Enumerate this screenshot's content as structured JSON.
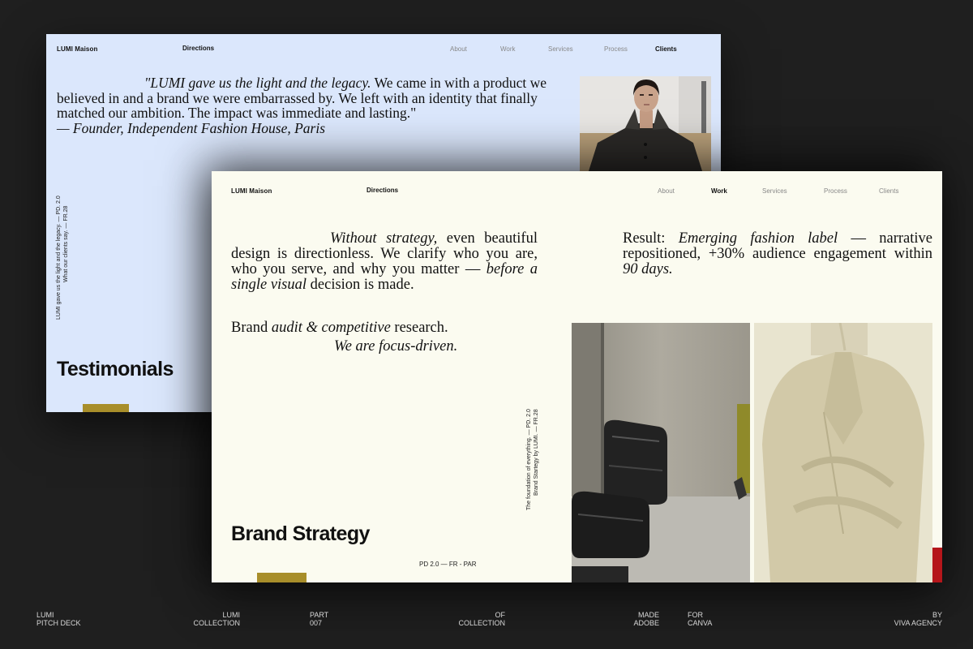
{
  "back_slide": {
    "nav": {
      "brand": "LUMI Maison",
      "directions": "Directions",
      "items": [
        {
          "label": "About",
          "active": false
        },
        {
          "label": "Work",
          "active": false
        },
        {
          "label": "Services",
          "active": false
        },
        {
          "label": "Process",
          "active": false
        },
        {
          "label": "Clients",
          "active": true
        }
      ]
    },
    "quote": {
      "italic_lead": "\"LUMI gave us the light and the legacy.",
      "body": " We came in with a product we believed in and a brand we were embarrassed by. We left with an identity that finally matched our ambition. The impact was immediate and lasting.\"",
      "attribution": "— Founder, Independent Fashion House, Paris"
    },
    "side_text": {
      "line1": "LUMI gave us the light and the legacy. — PD. 2.0",
      "line2": "What our clients say. — FR.28"
    },
    "title": "Testimonials",
    "accent_color": "#a88e2a",
    "background": "#dbe7fc"
  },
  "front_slide": {
    "nav": {
      "brand": "LUMI Maison",
      "directions": "Directions",
      "items": [
        {
          "label": "About",
          "active": false
        },
        {
          "label": "Work",
          "active": true
        },
        {
          "label": "Services",
          "active": false
        },
        {
          "label": "Process",
          "active": false
        },
        {
          "label": "Clients",
          "active": false
        }
      ]
    },
    "intro": {
      "italic1": "Without strategy,",
      "text1": " even beautiful design is directionless. We clarify who you are, who you serve, and why you matter — ",
      "italic2": "before a single visual",
      "text2": " decision is made."
    },
    "result": {
      "prefix": "Result: ",
      "italic1": "Emerging fashion label",
      "text1": " — narrative repositioned, +30% audience engagement within ",
      "italic2": "90 days.",
      "text2": ""
    },
    "audit": {
      "prefix": "Brand ",
      "italic": "audit & competitive",
      "suffix": " research."
    },
    "focus": "We are focus-driven.",
    "side_text": {
      "line1": "The foundation of everything. — PD. 2.0",
      "line2": "Brand Startegy by LUMI. — FR.28"
    },
    "title": "Brand Strategy",
    "code": "PD 2.0 — FR - PAR",
    "accent_color": "#a88e2a",
    "red_color": "#b5161b",
    "background": "#fbfbf0"
  },
  "footer": [
    {
      "line1": "LUMI",
      "line2": "PITCH DECK",
      "align": "left"
    },
    {
      "line1": "LUMI",
      "line2": "COLLECTION",
      "align": "right"
    },
    {
      "line1": "PART",
      "line2": "007",
      "align": "left"
    },
    {
      "line1": "OF",
      "line2": "COLLECTION",
      "align": "right"
    },
    {
      "line1": "MADE",
      "line2": "ADOBE",
      "align": "right"
    },
    {
      "line1": "FOR",
      "line2": "CANVA",
      "align": "left"
    },
    {
      "line1": "BY",
      "line2": "VIVA AGENCY",
      "align": "right"
    }
  ]
}
